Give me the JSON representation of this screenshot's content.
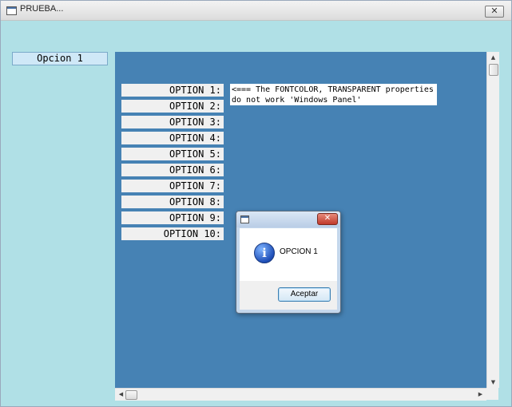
{
  "window": {
    "title": "PRUEBA...",
    "close_glyph": "✕"
  },
  "field": {
    "value": "Opcion 1"
  },
  "panel": {
    "options": [
      "OPTION 1:",
      "OPTION 2:",
      "OPTION 3:",
      "OPTION 4:",
      "OPTION 5:",
      "OPTION 6:",
      "OPTION 7:",
      "OPTION 8:",
      "OPTION 9:",
      "OPTION 10:"
    ],
    "note": "<=== The FONTCOLOR, TRANSPARENT properties do not work 'Windows Panel'"
  },
  "dialog": {
    "message": "OPCION 1",
    "accept_label": "Aceptar",
    "close_glyph": "✕",
    "icon_glyph": "i"
  },
  "colors": {
    "background": "#b0e0e6",
    "panel": "#4682b4"
  }
}
